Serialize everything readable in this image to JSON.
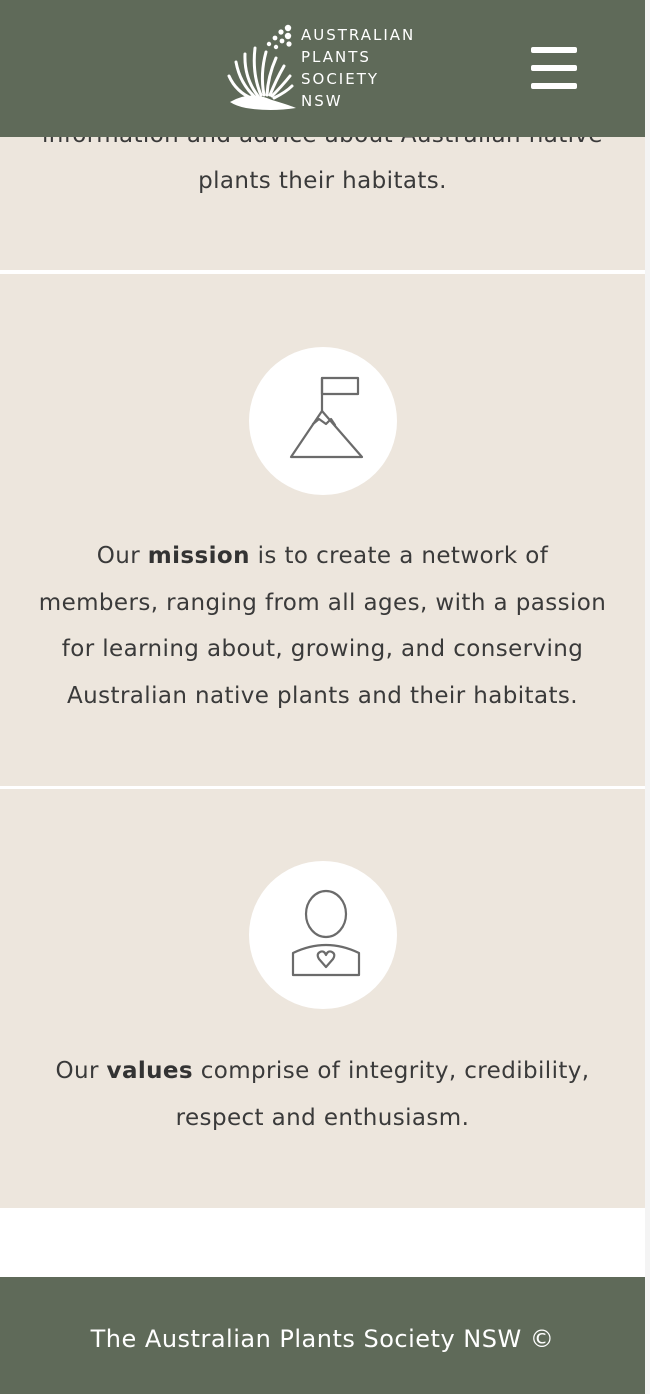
{
  "header": {
    "logo_lines": [
      "AUSTRALIAN",
      "PLANTS",
      "SOCIETY",
      "NSW"
    ],
    "menu_icon": "hamburger-menu-icon"
  },
  "top_section": {
    "text_line_1": "information and advice about Australian native",
    "text_line_2": "plants their habitats."
  },
  "mission": {
    "icon": "mountain-flag-icon",
    "prefix": "Our",
    "keyword": "mission",
    "line_1_rest": " is to create a network of",
    "line_2": "members, ranging from all ages, with a passion",
    "line_3": "for learning about, growing, and conserving",
    "line_4": "Australian native plants and their habitats."
  },
  "values": {
    "icon": "person-heart-icon",
    "prefix": "Our",
    "keyword": "values",
    "line_1_rest": " comprise of integrity, credibility,",
    "line_2": "respect and enthusiasm."
  },
  "footer": {
    "text": "The Australian Plants Society NSW ©"
  },
  "colors": {
    "header_bg": "#5f6a59",
    "section_bg": "#ede6dd",
    "text": "#3a3a3a",
    "icon_stroke": "#6b6b6b"
  }
}
